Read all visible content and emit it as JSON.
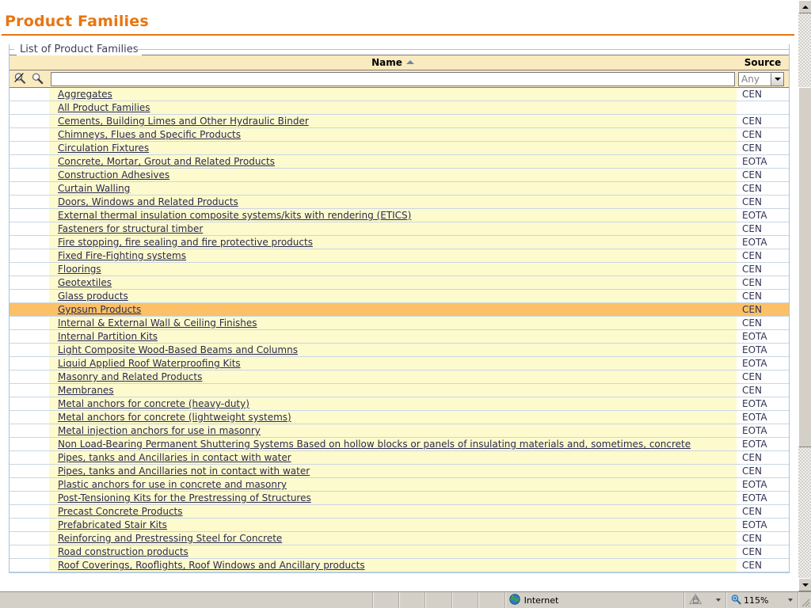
{
  "page": {
    "title": "Product Families",
    "panel_legend": "List of Product Families"
  },
  "toolbar": {
    "clear_filter_icon": "clear-filter-icon",
    "search_icon": "search-icon",
    "filter_value": "",
    "filter_placeholder": ""
  },
  "grid": {
    "columns": {
      "select": "",
      "name": "Name",
      "source": "Source"
    },
    "sort": {
      "column": "Name",
      "direction": "ascending",
      "glyph": "▲"
    },
    "source_filter": {
      "selected": "Any",
      "options": [
        "Any",
        "CEN",
        "EOTA"
      ]
    },
    "rows": [
      {
        "name": "Aggregates",
        "source": "CEN",
        "selected": false
      },
      {
        "name": "All Product Families",
        "source": "",
        "selected": false
      },
      {
        "name": "Cements, Building Limes and Other Hydraulic Binder",
        "source": "CEN",
        "selected": false
      },
      {
        "name": "Chimneys, Flues and Specific Products",
        "source": "CEN",
        "selected": false
      },
      {
        "name": "Circulation Fixtures",
        "source": "CEN",
        "selected": false
      },
      {
        "name": "Concrete, Mortar, Grout and Related Products",
        "source": "EOTA",
        "selected": false
      },
      {
        "name": "Construction Adhesives",
        "source": "CEN",
        "selected": false
      },
      {
        "name": "Curtain Walling",
        "source": "CEN",
        "selected": false
      },
      {
        "name": "Doors, Windows and Related Products",
        "source": "CEN",
        "selected": false
      },
      {
        "name": "External thermal insulation composite systems/kits with rendering (ETICS)",
        "source": "EOTA",
        "selected": false
      },
      {
        "name": "Fasteners for structural timber",
        "source": "CEN",
        "selected": false
      },
      {
        "name": "Fire stopping, fire sealing and fire protective products",
        "source": "EOTA",
        "selected": false
      },
      {
        "name": "Fixed Fire-Fighting systems",
        "source": "CEN",
        "selected": false
      },
      {
        "name": "Floorings",
        "source": "CEN",
        "selected": false
      },
      {
        "name": "Geotextiles",
        "source": "CEN",
        "selected": false
      },
      {
        "name": "Glass products",
        "source": "CEN",
        "selected": false
      },
      {
        "name": "Gypsum Products",
        "source": "CEN",
        "selected": true
      },
      {
        "name": "Internal & External Wall & Ceiling Finishes",
        "source": "CEN",
        "selected": false
      },
      {
        "name": "Internal Partition Kits",
        "source": "EOTA",
        "selected": false
      },
      {
        "name": "Light Composite Wood-Based Beams and Columns",
        "source": "EOTA",
        "selected": false
      },
      {
        "name": "Liquid Applied Roof Waterproofing Kits",
        "source": "EOTA",
        "selected": false
      },
      {
        "name": "Masonry and Related Products",
        "source": "CEN",
        "selected": false
      },
      {
        "name": "Membranes",
        "source": "CEN",
        "selected": false
      },
      {
        "name": "Metal anchors for concrete (heavy-duty)",
        "source": "EOTA",
        "selected": false
      },
      {
        "name": "Metal anchors for concrete (lightweight systems)",
        "source": "EOTA",
        "selected": false
      },
      {
        "name": "Metal injection anchors for use in masonry",
        "source": "EOTA",
        "selected": false
      },
      {
        "name": "Non Load-Bearing Permanent Shuttering Systems Based on hollow blocks or panels of insulating materials and, sometimes, concrete",
        "source": "EOTA",
        "selected": false
      },
      {
        "name": "Pipes, tanks and Ancillaries in contact with water",
        "source": "CEN",
        "selected": false
      },
      {
        "name": "Pipes, tanks and Ancillaries not in contact with water",
        "source": "CEN",
        "selected": false
      },
      {
        "name": "Plastic anchors for use in concrete and masonry",
        "source": "EOTA",
        "selected": false
      },
      {
        "name": "Post-Tensioning Kits for the Prestressing of Structures",
        "source": "EOTA",
        "selected": false
      },
      {
        "name": "Precast Concrete Products",
        "source": "CEN",
        "selected": false
      },
      {
        "name": "Prefabricated Stair Kits",
        "source": "EOTA",
        "selected": false
      },
      {
        "name": "Reinforcing and Prestressing Steel for Concrete",
        "source": "CEN",
        "selected": false
      },
      {
        "name": "Road construction products",
        "source": "CEN",
        "selected": false
      },
      {
        "name": "Roof Coverings, Rooflights, Roof Windows and Ancillary products",
        "source": "CEN",
        "selected": false
      }
    ]
  },
  "scrollbar": {
    "up_arrow": "scroll-up-icon",
    "down_arrow": "scroll-down-icon",
    "thumb": "scroll-thumb"
  },
  "statusbar": {
    "zone_icon": "globe-icon",
    "zone_label": "Internet",
    "protected_icon": "lock-icon",
    "zoom_icon": "zoom-magnifier-icon",
    "zoom_level": "115%"
  },
  "colors": {
    "accent_orange": "#E87511",
    "header_cream": "#FAEAC0",
    "row_cream": "#FDFACD",
    "selected_row": "#FBC068",
    "panel_border": "#A8C4DC",
    "link_text": "#2B2B4D"
  }
}
